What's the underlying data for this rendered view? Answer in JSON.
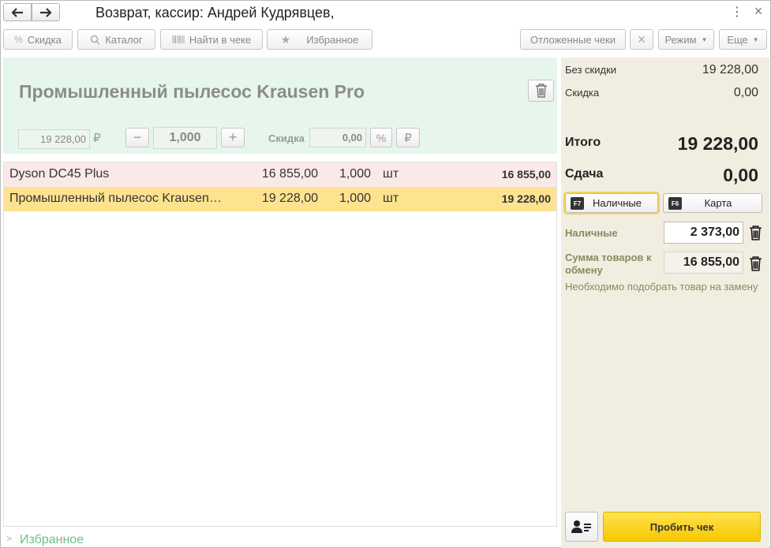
{
  "window": {
    "title": "Возврат, кассир: Андрей Кудрявцев,"
  },
  "toolbar": {
    "discount": "Скидка",
    "catalog": "Каталог",
    "find_in_receipt": "Найти в чеке",
    "favorites": "Избранное",
    "deferred_receipts": "Отложенные чеки",
    "mode": "Режим",
    "more": "Еще"
  },
  "product": {
    "name": "Промышленный пылесос Krausen Pro",
    "price": "19 228,00",
    "currency_symbol": "₽",
    "quantity": "1,000",
    "discount_label": "Скидка",
    "discount_value": "0,00",
    "percent_symbol": "%",
    "ruble_symbol": "₽"
  },
  "items": [
    {
      "name": "Dyson DC45 Plus",
      "price": "16 855,00",
      "qty": "1,000",
      "unit": "шт",
      "sum": "16 855,00"
    },
    {
      "name": "Промышленный пылесос Krausen Pro",
      "price": "19 228,00",
      "qty": "1,000",
      "unit": "шт",
      "sum": "19 228,00"
    }
  ],
  "favorites_bar": {
    "label": "Избранное"
  },
  "totals": {
    "no_discount_label": "Без скидки",
    "no_discount_value": "19 228,00",
    "discount_label": "Скидка",
    "discount_value": "0,00",
    "total_label": "Итого",
    "total_value": "19 228,00",
    "change_label": "Сдача",
    "change_value": "0,00"
  },
  "payment": {
    "cash_key": "F7",
    "cash_label": "Наличные",
    "card_key": "F6",
    "card_label": "Карта",
    "cash_amount_label": "Наличные",
    "cash_amount_value": "2 373,00",
    "exchange_label": "Сумма товаров к обмену",
    "exchange_value": "16 855,00",
    "note": "Необходимо подобрать товар на замену"
  },
  "actions": {
    "print_receipt": "Пробить чек"
  },
  "colors": {
    "product_panel_bg": "#e6f6ec",
    "row_returned_bg": "#fbe9e9",
    "row_selected_bg": "#fde38f",
    "right_panel_bg": "#f1ede0",
    "print_button": "#f7c800",
    "favorites_text": "#6bc08a"
  }
}
